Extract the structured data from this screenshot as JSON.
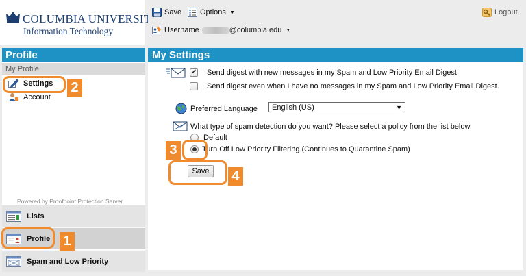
{
  "logo": {
    "university": "COLUMBIA UNIVERSITY",
    "department": "Information Technology"
  },
  "toolbar": {
    "save_label": "Save",
    "options_label": "Options",
    "logout_label": "Logout",
    "username_label": "Username",
    "username_domain": "@columbia.edu"
  },
  "sidebar": {
    "header": "Profile",
    "subheader": "My Profile",
    "links": [
      {
        "label": "Settings",
        "icon": "pencil-icon"
      },
      {
        "label": "Account",
        "icon": "user-icon"
      }
    ],
    "powered_by": "Powered by Proofpoint Protection Server",
    "tabs": [
      {
        "label": "Lists",
        "icon": "lists-icon"
      },
      {
        "label": "Profile",
        "icon": "profile-card-icon"
      },
      {
        "label": "Spam and Low Priority",
        "icon": "spam-icon"
      }
    ]
  },
  "main": {
    "header": "My Settings",
    "digest": {
      "option1": "Send digest with new messages in my Spam and Low Priority Email Digest.",
      "option1_checked": true,
      "option2": "Send digest even when I have no messages in my Spam and Low Priority Email Digest.",
      "option2_checked": false
    },
    "language": {
      "label": "Preferred Language",
      "selected": "English (US)"
    },
    "spam_policy": {
      "question": "What type of spam detection do you want? Please select a policy from the list below.",
      "options": [
        "Default",
        "Turn Off Low Priority Filtering (Continues to Quarantine Spam)"
      ],
      "selected_index": 1
    },
    "save_label": "Save"
  },
  "annotations": {
    "color": "#ef8a2d",
    "steps": [
      "1",
      "2",
      "3",
      "4"
    ]
  },
  "colors": {
    "header_blue": "#1f92c5",
    "logo_navy": "#1c3f72",
    "annotation_orange": "#ef8a2d"
  }
}
